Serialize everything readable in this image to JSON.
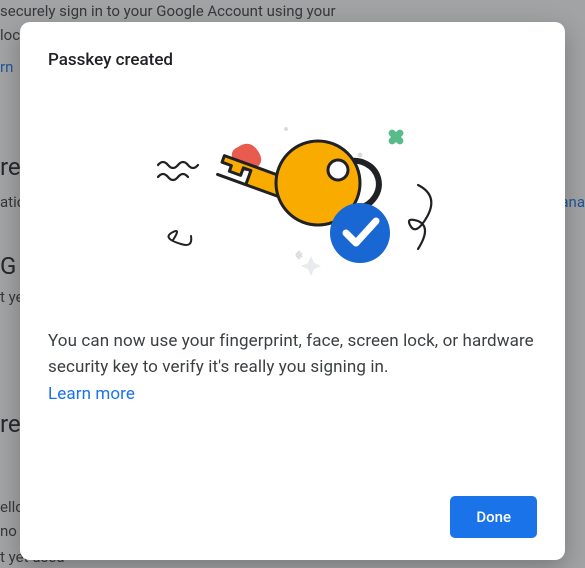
{
  "backdrop": {
    "line1": "securely sign in to your Google Account using your",
    "line2": "lock",
    "link1": "rn",
    "heading1": "re",
    "sub1": "atic",
    "link2": "ana",
    "heading2": "G",
    "sub2": "t ye",
    "heading3": "re",
    "line3": "ello",
    "line4": "no",
    "line5": "t yet used"
  },
  "dialog": {
    "title": "Passkey created",
    "body": "You can now use your fingerprint, face, screen lock, or hardware security key to verify it's really you signing in.",
    "learn_more": "Learn more",
    "done": "Done"
  },
  "colors": {
    "primary": "#1a73e8",
    "key": "#f9ab00",
    "check_bg": "#1967d2",
    "accent_red": "#ea4335",
    "accent_green": "#34a853"
  }
}
